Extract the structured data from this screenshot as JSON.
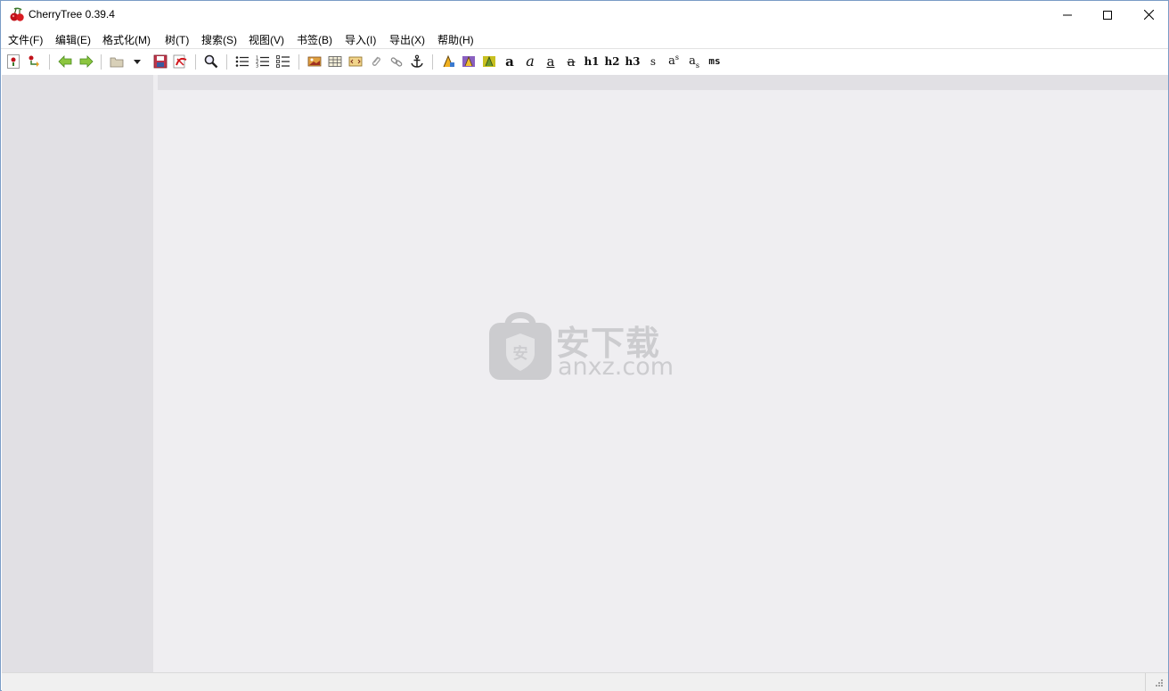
{
  "window": {
    "title": "CherryTree 0.39.4"
  },
  "menu": [
    {
      "label": "文件(F)"
    },
    {
      "label": "编辑(E)"
    },
    {
      "label": "格式化(M)"
    },
    {
      "label": "树(T)"
    },
    {
      "label": "搜索(S)"
    },
    {
      "label": "视图(V)"
    },
    {
      "label": "书签(B)"
    },
    {
      "label": "导入(I)"
    },
    {
      "label": "导出(X)"
    },
    {
      "label": "帮助(H)"
    }
  ],
  "toolbar": {
    "text_buttons": {
      "bold": "a",
      "italic": "a",
      "underline": "a",
      "strikethrough": "a",
      "h1": "h1",
      "h2": "h2",
      "h3": "h3",
      "small": "s",
      "superscript": "a",
      "subscript": "a",
      "monospace": "ms"
    }
  },
  "watermark": {
    "cn": "安下载",
    "en": "anxz.com"
  },
  "colors": {
    "tree_bg": "#e1e0e4",
    "editor_bg": "#efeef1",
    "watermark": "#c9c9cc"
  }
}
